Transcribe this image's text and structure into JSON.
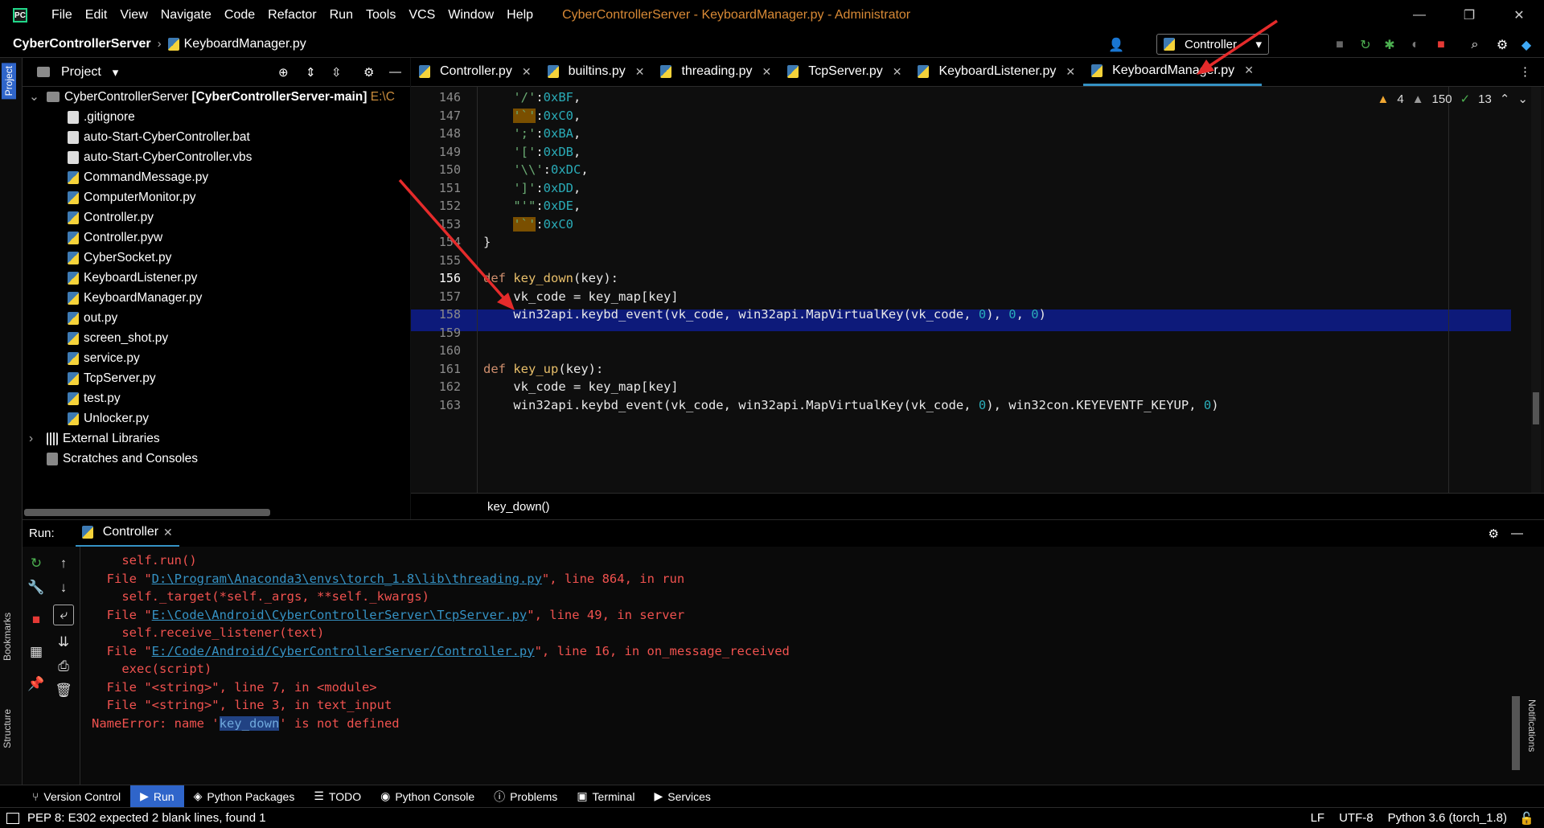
{
  "window": {
    "menu": [
      "File",
      "Edit",
      "View",
      "Navigate",
      "Code",
      "Refactor",
      "Run",
      "Tools",
      "VCS",
      "Window",
      "Help"
    ],
    "title": "CyberControllerServer - KeyboardManager.py - Administrator"
  },
  "navbar": {
    "project": "CyberControllerServer",
    "file": "KeyboardManager.py",
    "run_config": "Controller"
  },
  "project_panel": {
    "title": "Project",
    "root": "CyberControllerServer",
    "root_module": "[CyberControllerServer-main]",
    "root_path": "E:\\C",
    "files": [
      ".gitignore",
      "auto-Start-CyberController.bat",
      "auto-Start-CyberController.vbs",
      "CommandMessage.py",
      "ComputerMonitor.py",
      "Controller.py",
      "Controller.pyw",
      "CyberSocket.py",
      "KeyboardListener.py",
      "KeyboardManager.py",
      "out.py",
      "screen_shot.py",
      "service.py",
      "TcpServer.py",
      "test.py",
      "Unlocker.py"
    ],
    "external": "External Libraries",
    "scratches": "Scratches and Consoles"
  },
  "tabs": [
    "Controller.py",
    "builtins.py",
    "threading.py",
    "TcpServer.py",
    "KeyboardListener.py",
    "KeyboardManager.py"
  ],
  "inspections": {
    "warnings": "4",
    "weak": "150",
    "ok": "13"
  },
  "editor": {
    "lines": [
      {
        "n": "146",
        "html": "    <span class='str'>'/'</span>:<span class='hex'>0xBF</span>,"
      },
      {
        "n": "147",
        "html": "    <span class='str hl'>'`'</span>:<span class='hex'>0xC0</span>,"
      },
      {
        "n": "148",
        "html": "    <span class='str'>';'</span>:<span class='hex'>0xBA</span>,"
      },
      {
        "n": "149",
        "html": "    <span class='str'>'['</span>:<span class='hex'>0xDB</span>,"
      },
      {
        "n": "150",
        "html": "    <span class='str'>'\\\\'</span>:<span class='hex'>0xDC</span>,"
      },
      {
        "n": "151",
        "html": "    <span class='str'>']'</span>:<span class='hex'>0xDD</span>,"
      },
      {
        "n": "152",
        "html": "    <span class='str'>\"'\"</span>:<span class='hex'>0xDE</span>,"
      },
      {
        "n": "153",
        "html": "    <span class='str hl'>'`'</span>:<span class='hex'>0xC0</span>"
      },
      {
        "n": "154",
        "html": "}"
      },
      {
        "n": "155",
        "html": ""
      },
      {
        "n": "156",
        "html": "<span class='kw'>def</span> <span class='fn'>key_down</span>(key):"
      },
      {
        "n": "157",
        "html": "    vk_code = key_map[key]"
      },
      {
        "n": "158",
        "html": "    win32api.keybd_event(vk_code, win32api.MapVirtualKey(vk_code, <span class='num'>0</span>), <span class='num'>0</span>, <span class='num'>0</span>)"
      },
      {
        "n": "159",
        "html": ""
      },
      {
        "n": "160",
        "html": ""
      },
      {
        "n": "161",
        "html": "<span class='kw'>def</span> <span class='fn'>key_up</span>(key):"
      },
      {
        "n": "162",
        "html": "    vk_code = key_map[key]"
      },
      {
        "n": "163",
        "html": "    win32api.keybd_event(vk_code, win32api.MapVirtualKey(vk_code, <span class='num'>0</span>), win32con.KEYEVENTF_KEYUP, <span class='num'>0</span>)"
      }
    ],
    "current_line": "156",
    "breadcrumb": "key_down()"
  },
  "run": {
    "label": "Run:",
    "tab": "Controller",
    "console": [
      {
        "html": "    self.run()"
      },
      {
        "html": "  File \"<span class='link'>D:\\Program\\Anaconda3\\envs\\torch_1.8\\lib\\threading.py</span>\", line 864, in run"
      },
      {
        "html": "    self._target(*self._args, **self._kwargs)"
      },
      {
        "html": "  File \"<span class='link'>E:\\Code\\Android\\CyberControllerServer\\TcpServer.py</span>\", line 49, in server"
      },
      {
        "html": "    self.receive_listener(text)"
      },
      {
        "html": "  File \"<span class='link'>E:/Code/Android/CyberControllerServer/Controller.py</span>\", line 16, in on_message_received"
      },
      {
        "html": "    exec(script)"
      },
      {
        "html": "  File \"&lt;string&gt;\", line 7, in &lt;module&gt;"
      },
      {
        "html": "  File \"&lt;string&gt;\", line 3, in text_input"
      },
      {
        "html": "NameError: name '<span class='selword'>key_down</span>' is not defined"
      }
    ]
  },
  "toolwindows": [
    "Version Control",
    "Run",
    "Python Packages",
    "TODO",
    "Python Console",
    "Problems",
    "Terminal",
    "Services"
  ],
  "status": {
    "message": "PEP 8: E302 expected 2 blank lines, found 1",
    "line_sep": "LF",
    "encoding": "UTF-8",
    "interpreter": "Python 3.6 (torch_1.8)"
  },
  "side_tabs": {
    "project": "Project",
    "bookmarks": "Bookmarks",
    "structure": "Structure",
    "notifications": "Notifications"
  }
}
